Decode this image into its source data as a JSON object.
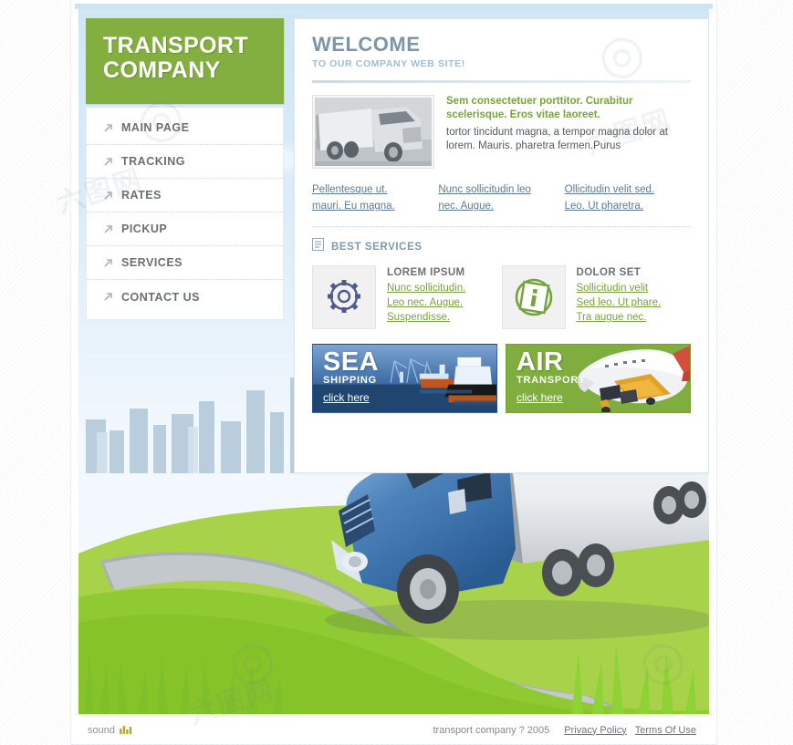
{
  "site": {
    "brand_line1": "TRANSPORT",
    "brand_line2": "COMPANY",
    "brand_color": "#82af40"
  },
  "sidebar": {
    "items": [
      {
        "label": "MAIN PAGE",
        "icon": "arrow-up-right-icon"
      },
      {
        "label": "TRACKING",
        "icon": "arrow-up-right-icon"
      },
      {
        "label": "RATES",
        "icon": "arrow-up-right-icon"
      },
      {
        "label": "PICKUP",
        "icon": "arrow-up-right-icon"
      },
      {
        "label": "SERVICES",
        "icon": "arrow-up-right-icon"
      },
      {
        "label": "CONTACT US",
        "icon": "arrow-up-right-icon"
      }
    ]
  },
  "welcome": {
    "title": "WELCOME",
    "subtitle": "TO OUR COMPANY WEB SITE!",
    "title_color": "#7b95aa"
  },
  "article": {
    "image_alt": "truck-photo",
    "headline": "Sem consectetuer porttitor. Curabitur scelerisque. Eros vitae laoreet.",
    "headline_color": "#77a637",
    "body": "tortor tincidunt magna, a tempor magna dolor at lorem. Mauris. pharetra fermen.Purus"
  },
  "link_columns": [
    {
      "lines": [
        "Pellentesque ut.",
        "mauri. Eu magna."
      ]
    },
    {
      "lines": [
        "Nunc sollicitudin leo",
        "nec. Augue."
      ]
    },
    {
      "lines": [
        "Ollicitudin velit sed.",
        "Leo. Ut pharetra,"
      ]
    }
  ],
  "best_services": {
    "heading": "BEST SERVICES",
    "heading_icon": "document-icon",
    "items": [
      {
        "icon": "gear-icon",
        "icon_color": "#4f5a8c",
        "title": "LOREM IPSUM",
        "links": [
          "Nunc sollicitudin.",
          "Leo nec. Augue.",
          "Suspendisse."
        ]
      },
      {
        "icon": "info-icon",
        "icon_color": "#76a43a",
        "title": "DOLOR SET",
        "links": [
          "Sollicitudin velit",
          "Sed leo. Ut phare.",
          "Tra augue nec."
        ]
      }
    ]
  },
  "banners": [
    {
      "big": "SEA",
      "small": "SHIPPING",
      "link": "click here",
      "theme": "sea",
      "bg_color": "#2d5da0"
    },
    {
      "big": "AIR",
      "small": "TRANSPORT",
      "link": "click here",
      "theme": "air",
      "bg_color": "#7fae3e"
    }
  ],
  "footer": {
    "sound_label": "sound",
    "sound_icon": "equalizer-icon",
    "copyright": "transport company  ? 2005",
    "links": [
      "Privacy Policy",
      "Terms Of Use"
    ]
  }
}
